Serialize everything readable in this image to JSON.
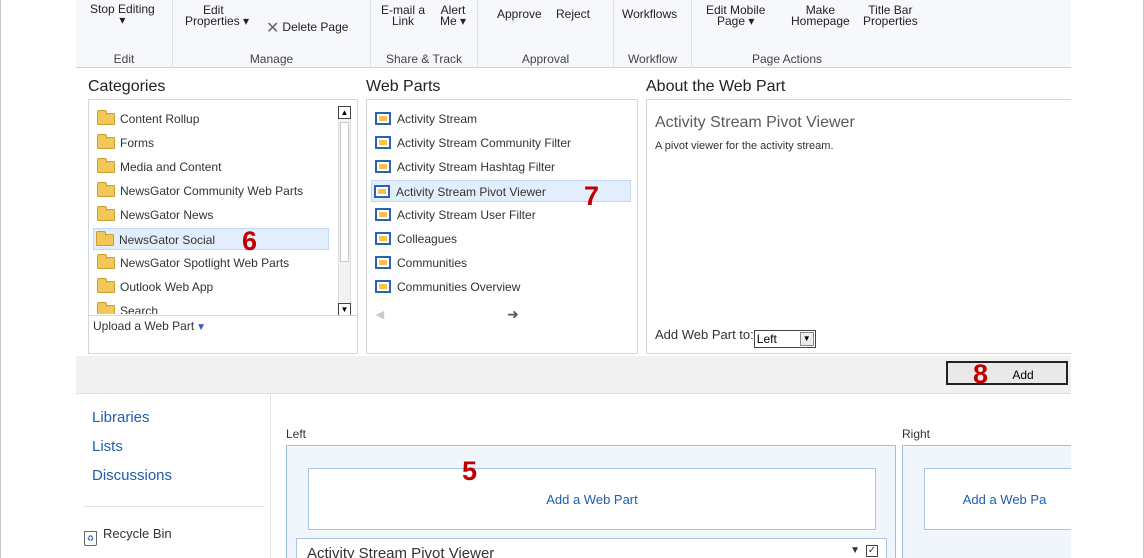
{
  "ribbon": {
    "groups": [
      {
        "label": "Edit"
      },
      {
        "label": "Manage"
      },
      {
        "label": "Share & Track"
      },
      {
        "label": "Approval"
      },
      {
        "label": "Workflow"
      },
      {
        "label": "Page Actions"
      }
    ],
    "buttons": {
      "stop_editing": "Stop Editing",
      "stop_editing_arrow": "▾",
      "edit_properties_top": "Edit",
      "edit_properties": "Properties ▾",
      "delete_page": "Delete Page",
      "email_link_top": "E-mail a",
      "email_link": "Link",
      "alert_me_top": "Alert",
      "alert_me": "Me ▾",
      "approve": "Approve",
      "reject": "Reject",
      "workflows": "Workflows",
      "edit_mobile_top": "Edit Mobile",
      "edit_mobile": "Page ▾",
      "make_homepage_top": "Make",
      "make_homepage": "Homepage",
      "title_bar_top": "Title Bar",
      "title_bar": "Properties"
    }
  },
  "categories": {
    "title": "Categories",
    "items": [
      "Content Rollup",
      "Forms",
      "Media and Content",
      "NewsGator Community Web Parts",
      "NewsGator News",
      "NewsGator Social",
      "NewsGator Spotlight Web Parts",
      "Outlook Web App",
      "Search"
    ],
    "selected": "NewsGator Social",
    "upload_label": "Upload a Web Part"
  },
  "web_parts": {
    "title": "Web Parts",
    "items": [
      "Activity Stream",
      "Activity Stream Community Filter",
      "Activity Stream Hashtag Filter",
      "Activity Stream Pivot Viewer",
      "Activity Stream User Filter",
      "Colleagues",
      "Communities",
      "Communities Overview"
    ],
    "selected": "Activity Stream Pivot Viewer"
  },
  "about": {
    "title": "About the Web Part",
    "name": "Activity Stream Pivot Viewer",
    "description": "A pivot viewer for the activity stream.",
    "add_to_label": "Add Web Part to:",
    "add_to_value": "Left"
  },
  "add_button": "Add",
  "annotations": {
    "n5": "5",
    "n6": "6",
    "n7": "7",
    "n8": "8"
  },
  "left_nav": {
    "links": [
      "Libraries",
      "Lists",
      "Discussions"
    ],
    "recycle_bin": "Recycle Bin"
  },
  "zones": {
    "left_label": "Left",
    "right_label": "Right",
    "add_web_part": "Add a Web Part",
    "right_add_web_part": "Add a Web Pa",
    "webpart_title": "Activity Stream Pivot Viewer"
  }
}
